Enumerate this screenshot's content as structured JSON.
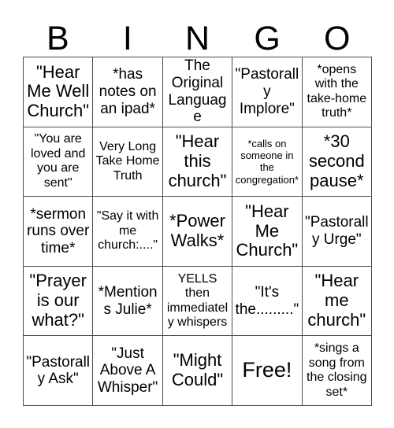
{
  "card": {
    "title": "BINGO",
    "header_letters": [
      "B",
      "I",
      "N",
      "G",
      "O"
    ],
    "grid": {
      "columns": 5,
      "rows": 5,
      "border_color": "#4d4d4d",
      "background_color": "#ffffff",
      "text_color": "#000000"
    },
    "cells": [
      {
        "text": "\"Hear Me Well Church\"",
        "size": "lg",
        "free": false
      },
      {
        "text": "*has notes on an ipad*",
        "size": "md",
        "free": false
      },
      {
        "text": "The Original Language",
        "size": "md",
        "free": false
      },
      {
        "text": "\"Pastorally Implore\"",
        "size": "md",
        "free": false
      },
      {
        "text": "*opens with the take-home truth*",
        "size": "sm",
        "free": false
      },
      {
        "text": "\"You are loved and you are sent\"",
        "size": "sm",
        "free": false
      },
      {
        "text": "Very Long Take Home Truth",
        "size": "sm",
        "free": false
      },
      {
        "text": "\"Hear this church\"",
        "size": "lg",
        "free": false
      },
      {
        "text": "*calls on someone in the congregation*",
        "size": "xs",
        "free": false
      },
      {
        "text": "*30 second pause*",
        "size": "lg",
        "free": false
      },
      {
        "text": "*sermon runs over time*",
        "size": "md",
        "free": false
      },
      {
        "text": "\"Say it with me church:....\"",
        "size": "sm",
        "free": false
      },
      {
        "text": "*Power Walks*",
        "size": "lg",
        "free": false
      },
      {
        "text": "\"Hear Me Church\"",
        "size": "lg",
        "free": false
      },
      {
        "text": "\"Pastorally Urge\"",
        "size": "md",
        "free": false
      },
      {
        "text": "\"Prayer is our what?\"",
        "size": "lg",
        "free": false
      },
      {
        "text": "*Mentions Julie*",
        "size": "md",
        "free": false
      },
      {
        "text": "YELLS then immediately whispers",
        "size": "sm",
        "free": false
      },
      {
        "text": "\"It's the.........\"",
        "size": "md",
        "free": false
      },
      {
        "text": "\"Hear me church\"",
        "size": "lg",
        "free": false
      },
      {
        "text": "\"Pastorally Ask\"",
        "size": "md",
        "free": false
      },
      {
        "text": "\"Just Above A Whisper\"",
        "size": "md",
        "free": false
      },
      {
        "text": "\"Might Could\"",
        "size": "lg",
        "free": false
      },
      {
        "text": "Free!",
        "size": "xl",
        "free": true
      },
      {
        "text": "*sings a song from the closing set*",
        "size": "sm",
        "free": false
      }
    ]
  }
}
